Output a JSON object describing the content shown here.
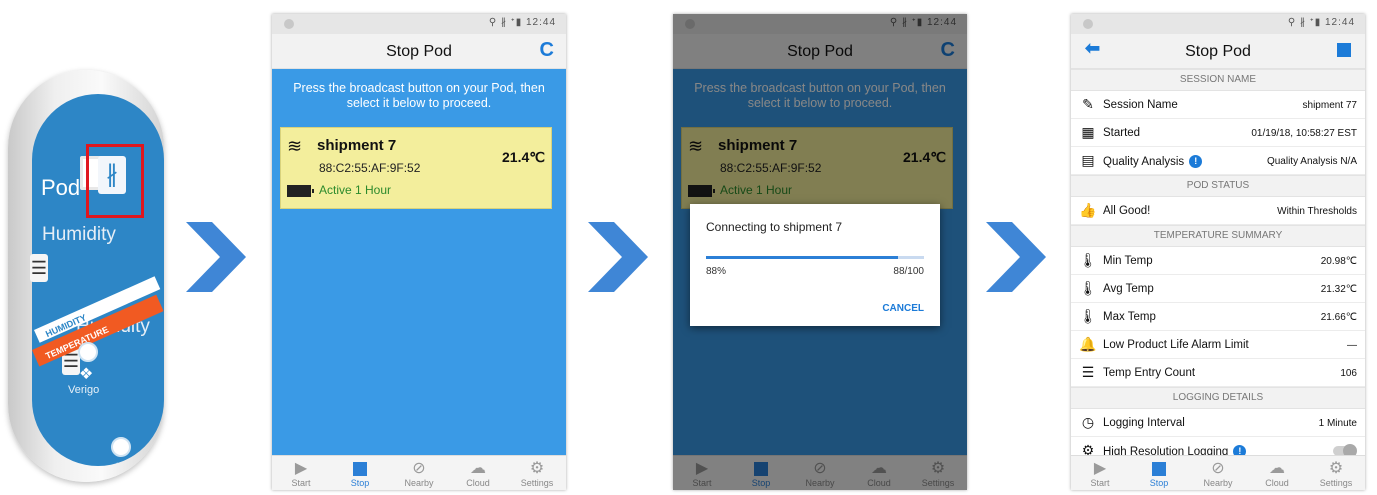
{
  "device": {
    "pod_label": "Pod",
    "sensor_label": "Humidity",
    "band_humidity": "HUMIDITY",
    "band_temperature": "TEMPERATURE",
    "brand": "Verigo",
    "bluetooth_icon": "bluetooth-icon",
    "highlight_color": "#e0161e"
  },
  "status_bar": {
    "icons": "⚲ ∦ ᐩ▮ 12:44",
    "time": "12:44"
  },
  "screen_title": "Stop Pod",
  "scan_screen": {
    "instruction": "Press the broadcast button on your Pod, then select it below to proceed.",
    "pod": {
      "name": "shipment 7",
      "mac": "88:C2:55:AF:9F:52",
      "temperature": "21.4℃",
      "status": "Active 1 Hour"
    }
  },
  "connect_dialog": {
    "title": "Connecting to shipment 7",
    "percent_label": "88%",
    "count_label": "88/100",
    "progress": 0.88,
    "cancel": "CANCEL"
  },
  "summary": {
    "sections": {
      "session_name": "SESSION NAME",
      "pod_status": "POD STATUS",
      "temperature_summary": "TEMPERATURE SUMMARY",
      "logging_details": "LOGGING DETAILS"
    },
    "rows": {
      "session_name": {
        "label": "Session Name",
        "value": "shipment 77"
      },
      "started": {
        "label": "Started",
        "value": "01/19/18, 10:58:27 EST"
      },
      "quality": {
        "label": "Quality Analysis",
        "value": "Quality Analysis N/A"
      },
      "all_good": {
        "label": "All Good!",
        "value": "Within Thresholds"
      },
      "min_temp": {
        "label": "Min Temp",
        "value": "20.98℃"
      },
      "avg_temp": {
        "label": "Avg Temp",
        "value": "21.32℃"
      },
      "max_temp": {
        "label": "Max Temp",
        "value": "21.66℃"
      },
      "alarm": {
        "label": "Low Product Life Alarm Limit",
        "value": "—"
      },
      "entry_count": {
        "label": "Temp Entry Count",
        "value": "106"
      },
      "interval": {
        "label": "Logging Interval",
        "value": "1 Minute"
      },
      "high_res": {
        "label": "High Resolution Logging",
        "value": ""
      }
    }
  },
  "nav": {
    "start": "Start",
    "stop": "Stop",
    "nearby": "Nearby",
    "cloud": "Cloud",
    "settings": "Settings"
  },
  "colors": {
    "accent": "#1c7bd8",
    "scan_background": "#3a9ae6",
    "card_background": "#f3ee9c",
    "arrow": "#3f86d6"
  }
}
